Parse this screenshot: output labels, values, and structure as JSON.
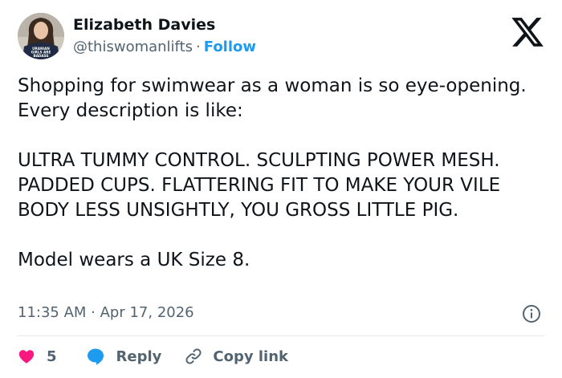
{
  "author": {
    "name": "Elizabeth Davies",
    "handle": "@thiswomanlifts",
    "separator": "·",
    "follow_label": "Follow",
    "shirt_text": [
      "URANIAN",
      "GIRLS ARE",
      "BADASS"
    ]
  },
  "platform_icon": "x-logo-icon",
  "post": {
    "paragraphs": [
      "Shopping for swimwear as a woman is so eye-opening. Every description is like:",
      "ULTRA TUMMY CONTROL. SCULPTING POWER MESH. PADDED CUPS. FLATTERING FIT TO MAKE YOUR VILE BODY LESS UNSIGHTLY, YOU GROSS LITTLE PIG.",
      "Model wears a UK Size 8."
    ],
    "timestamp": "11:35 AM · Apr 17, 2026"
  },
  "actions": {
    "like_count": "5",
    "reply_label": "Reply",
    "copy_link_label": "Copy link"
  },
  "colors": {
    "accent": "#1d9bf0",
    "like": "#f91880",
    "text": "#0f1419",
    "muted": "#536471"
  }
}
